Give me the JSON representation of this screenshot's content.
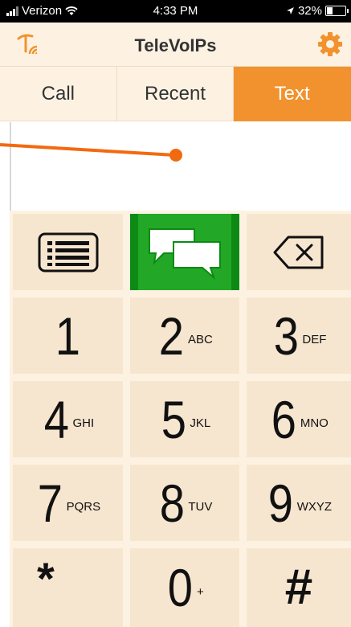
{
  "status_bar": {
    "carrier": "Verizon",
    "time": "4:33 PM",
    "battery": "32%",
    "battery_level": 0.32
  },
  "app_bar": {
    "title": "TeleVoIPs",
    "logo_icon": "televoips-logo-icon",
    "settings_icon": "gear-icon"
  },
  "tabs": [
    {
      "label": "Call",
      "active": false
    },
    {
      "label": "Recent",
      "active": false
    },
    {
      "label": "Text",
      "active": true
    }
  ],
  "keypad": {
    "function_keys": [
      {
        "icon": "contacts-list-icon"
      },
      {
        "icon": "chat-bubbles-icon"
      },
      {
        "icon": "backspace-icon"
      }
    ],
    "keys": [
      {
        "digit": "1",
        "letters": ""
      },
      {
        "digit": "2",
        "letters": "ABC"
      },
      {
        "digit": "3",
        "letters": "DEF"
      },
      {
        "digit": "4",
        "letters": "GHI"
      },
      {
        "digit": "5",
        "letters": "JKL"
      },
      {
        "digit": "6",
        "letters": "MNO"
      },
      {
        "digit": "7",
        "letters": "PQRS"
      },
      {
        "digit": "8",
        "letters": "TUV"
      },
      {
        "digit": "9",
        "letters": "WXYZ"
      },
      {
        "digit": "*",
        "letters": ""
      },
      {
        "digit": "0",
        "letters": "+"
      },
      {
        "digit": "#",
        "letters": ""
      }
    ]
  },
  "colors": {
    "accent": "#f2922e",
    "panel": "#fdf2e2",
    "key": "#f7e6cf",
    "sms_green": "#22a826"
  }
}
